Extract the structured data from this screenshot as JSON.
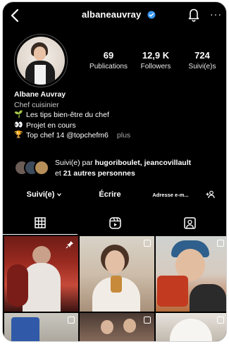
{
  "header": {
    "username": "albaneauvray",
    "more_label": "···"
  },
  "icons": {
    "back": "chevron-left-icon",
    "verified": "verified-badge-icon",
    "notifications": "bell-icon",
    "more": "more-horizontal-icon"
  },
  "colors": {
    "background": "#000000",
    "verified": "#3897f0",
    "text_secondary": "#a8a8a8"
  },
  "stats": [
    {
      "value": "69",
      "label": "Publications"
    },
    {
      "value": "12,9 K",
      "label": "Followers"
    },
    {
      "value": "724",
      "label": "Suivi(e)s"
    }
  ],
  "bio": {
    "name": "Albane Auvray",
    "category": "Chef cuisinier",
    "lines": [
      {
        "emoji": "🌱",
        "text": "Les tips bien-être du chef"
      },
      {
        "emoji": "👀",
        "text": "Projet en cours"
      },
      {
        "emoji": "🏆",
        "text": "Top chef 14  @topchefm6"
      }
    ],
    "more_label": "plus"
  },
  "followed_by": {
    "prefix": "Suivi(e) par ",
    "names": "hugoriboulet, jeancovillault",
    "middle": "et ",
    "others": "21 autres personnes"
  },
  "actions": {
    "following_label": "Suivi(e)",
    "message_label": "Écrire",
    "email_label": "Adresse e-m..."
  },
  "tabs": [
    "grid-tab",
    "reels-tab",
    "tagged-tab"
  ]
}
